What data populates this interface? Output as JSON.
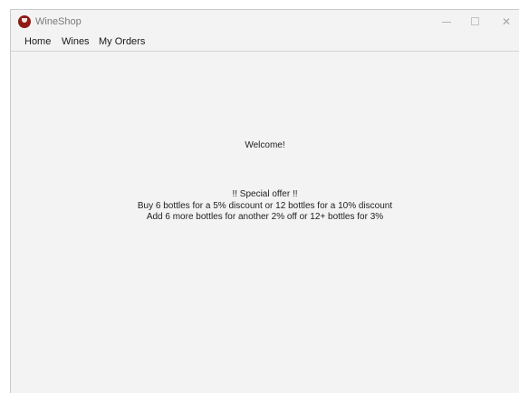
{
  "window": {
    "title": "WineShop",
    "icon": "wine-glass-icon",
    "controls": {
      "minimize": "minimize-icon",
      "maximize": "maximize-icon",
      "close": "close-icon",
      "close_glyph": "✕"
    }
  },
  "menu": {
    "items": [
      {
        "label": "Home"
      },
      {
        "label": "Wines"
      },
      {
        "label": "My Orders"
      }
    ]
  },
  "main": {
    "welcome": "Welcome!",
    "offer": {
      "heading": "!! Special offer !!",
      "line1": "Buy 6 bottles for a 5% discount or 12 bottles for a 10% discount",
      "line2": "Add 6 more bottles for another 2% off or 12+ bottles for 3%"
    }
  },
  "colors": {
    "window_bg": "#f3f3f3",
    "app_icon": "#8e1b14"
  }
}
